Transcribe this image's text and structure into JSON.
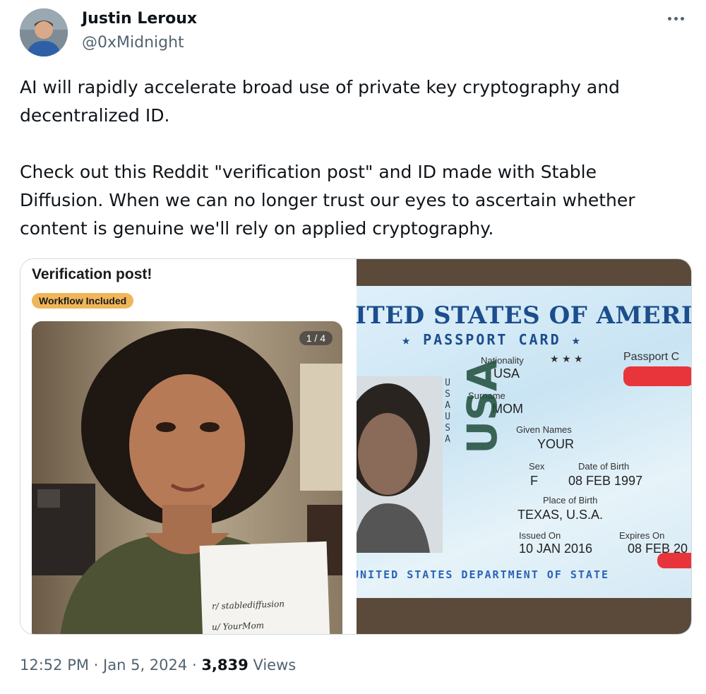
{
  "author": {
    "name": "Justin Leroux",
    "handle": "@0xMidnight"
  },
  "tweet": {
    "paragraph1": "AI will rapidly accelerate broad use of private key cryptography and\ndecentralized ID.",
    "paragraph2": "Check out this Reddit \"verification post\" and ID made with Stable\nDiffusion. When we can no longer trust our eyes to ascertain whether\ncontent is genuine we'll rely on applied cryptography."
  },
  "media_left": {
    "post_title": "Verification post!",
    "flair": "Workflow Included",
    "flair_color": "#f0b65a",
    "page_counter": "1 / 4",
    "note_line1": "r/ stablediffusion",
    "note_line2": "u/ YourMom"
  },
  "media_right": {
    "title": "ITED STATES OF AMERI",
    "subtitle": "★ PASSPORT CARD ★",
    "stars": "★ ★ ★",
    "passport_label": "Passport C",
    "vertical_text": "USAUSA",
    "nationality_label": "Nationality",
    "nationality": "USA",
    "surname_label": "Surname",
    "surname": "MOM",
    "given_names_label": "Given Names",
    "given_names": "YOUR",
    "sex_label": "Sex",
    "sex": "F",
    "dob_label": "Date of Birth",
    "dob": "08 FEB 1997",
    "pob_label": "Place of Birth",
    "pob": "TEXAS, U.S.A.",
    "issued_label": "Issued On",
    "issued": "10 JAN 2016",
    "expires_label": "Expires On",
    "expires": "08 FEB 20",
    "big_usa": "USA",
    "department": "UNITED STATES DEPARTMENT OF STATE",
    "redaction_color": "#e8353b"
  },
  "footer": {
    "time": "12:52 PM",
    "separator": "·",
    "date": "Jan 5, 2024",
    "views_count": "3,839",
    "views_label": "Views"
  }
}
